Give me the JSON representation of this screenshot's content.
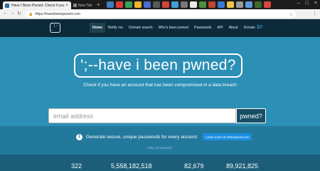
{
  "browser": {
    "active_tab_title": "Have I Been Pwned: Check if you ...",
    "second_tab_title": "New Tab",
    "url": "https://haveibeenpwned.com",
    "extension_colors": [
      "#3d7ebf",
      "#e03b3b",
      "#39a35a",
      "#f0b429",
      "#4a6cd4",
      "#5a5a5a",
      "#d6453d",
      "#3fa0d8",
      "#777777",
      "#e8e8e8",
      "#4c8f3c",
      "#c2452d",
      "#3b78d8",
      "#efc24a",
      "#999999",
      "#5e9ad9",
      "#3f6b2a",
      "#d44"
    ]
  },
  "nav": {
    "logo_text": "';--",
    "items": [
      "Home",
      "Notify me",
      "Domain search",
      "Who's been pwned",
      "Passwords",
      "API",
      "About",
      "Donate"
    ]
  },
  "hero": {
    "title": "';--have i been pwned?",
    "subtitle": "Check if you have an account that has been compromised in a data breach",
    "search_placeholder": "email address",
    "search_button": "pwned?"
  },
  "password_promo": {
    "text": "Generate secure, unique passwords for every account",
    "button": "Learn more at 1Password.com",
    "why_link": "Why 1Password?"
  },
  "stats": [
    "322",
    "5,558,182,518",
    "82,679",
    "89,921,825"
  ],
  "colors": {
    "navbar": "#0c2a3a",
    "hero": "#2c8fb5",
    "search_button": "#174e66",
    "promo_button": "#1a8fe0"
  }
}
